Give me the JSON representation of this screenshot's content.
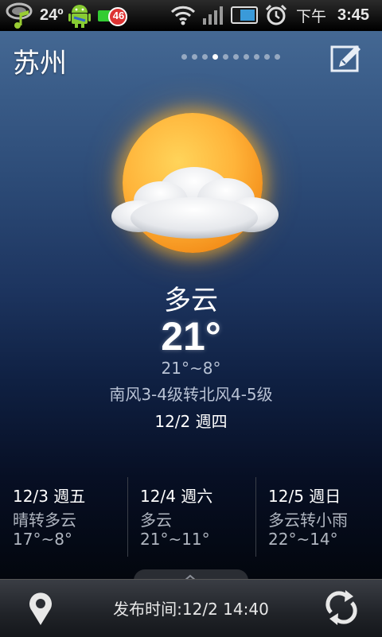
{
  "status_bar": {
    "temperature": "24º",
    "battery_level": "46",
    "time_period": "下午",
    "time": "3:45",
    "icons": [
      "music-note-icon",
      "android-icon",
      "battery-icon",
      "wifi-icon",
      "signal-icon",
      "screen-icon",
      "alarm-icon"
    ]
  },
  "header": {
    "city": "苏州",
    "page_count": 10,
    "active_page": 4,
    "edit_icon": "edit-icon"
  },
  "current": {
    "icon": "partly-cloudy-icon",
    "condition": "多云",
    "temperature": "21°",
    "range": "21°~8°",
    "wind": "南风3-4级转北风4-5级",
    "date": "12/2 週四"
  },
  "forecast": [
    {
      "date": "12/3 週五",
      "condition": "晴转多云",
      "range": "17°~8°"
    },
    {
      "date": "12/4 週六",
      "condition": "多云",
      "range": "21°~11°"
    },
    {
      "date": "12/5 週日",
      "condition": "多云转小雨",
      "range": "22°~14°"
    }
  ],
  "bottom_bar": {
    "publish_time": "发布时间:12/2 14:40",
    "location_icon": "location-pin-icon",
    "refresh_icon": "refresh-icon"
  },
  "colors": {
    "sun": "#ffb43a",
    "secondary_text": "#b8c2d4"
  }
}
